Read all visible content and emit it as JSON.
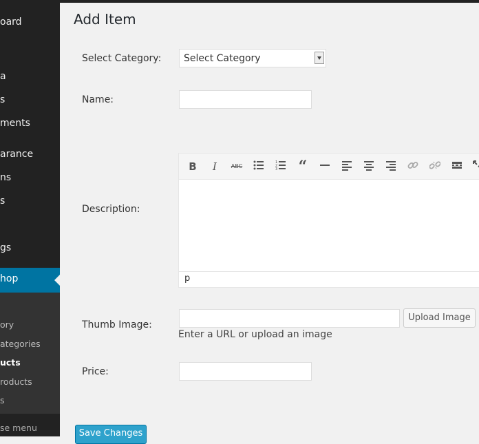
{
  "sidebar": {
    "items": [
      {
        "label": "oard",
        "name": "sidebar-item-dashboard"
      },
      {
        "label": "a",
        "name": "sidebar-item-media"
      },
      {
        "label": "s",
        "name": "sidebar-item-pages"
      },
      {
        "label": "ments",
        "name": "sidebar-item-comments"
      },
      {
        "label": "arance",
        "name": "sidebar-item-appearance"
      },
      {
        "label": "ns",
        "name": "sidebar-item-plugins"
      },
      {
        "label": "s",
        "name": "sidebar-item-users"
      },
      {
        "label": "gs",
        "name": "sidebar-item-settings"
      },
      {
        "label": "hop",
        "name": "sidebar-item-shop"
      }
    ],
    "submenu": [
      {
        "label": "ory"
      },
      {
        "label": "ategories"
      },
      {
        "label": "ucts"
      },
      {
        "label": "roducts"
      },
      {
        "label": "s"
      }
    ],
    "collapse_label": "se menu"
  },
  "page": {
    "title": "Add Item"
  },
  "form": {
    "category_label": "Select Category:",
    "category_value": "Select Category",
    "name_label": "Name:",
    "name_value": "",
    "description_label": "Description:",
    "editor_path": "p",
    "thumb_label": "Thumb Image:",
    "thumb_value": "",
    "upload_button": "Upload Image",
    "thumb_hint": "Enter a URL or upload an image",
    "price_label": "Price:",
    "price_value": "",
    "save_button": "Save Changes"
  },
  "toolbar_icons": [
    "bold-icon",
    "italic-icon",
    "strikethrough-icon",
    "bullet-list-icon",
    "numbered-list-icon",
    "blockquote-icon",
    "horizontal-rule-icon",
    "align-left-icon",
    "align-center-icon",
    "align-right-icon",
    "link-icon",
    "unlink-icon",
    "read-more-icon",
    "fullscreen-icon"
  ]
}
